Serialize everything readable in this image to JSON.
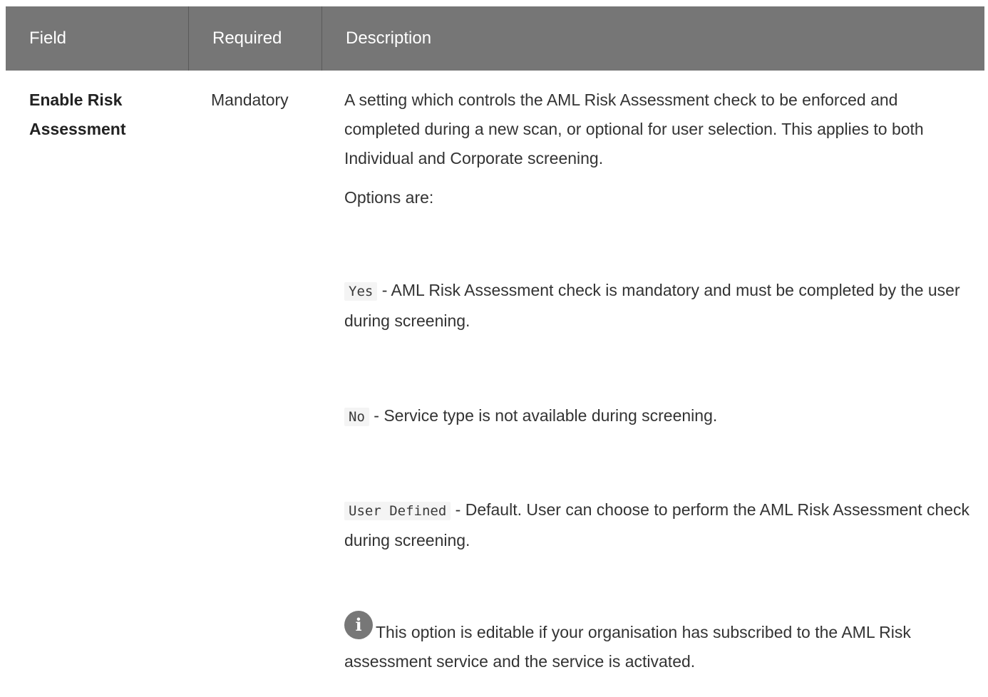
{
  "table": {
    "headers": {
      "field": "Field",
      "required": "Required",
      "description": "Description"
    },
    "row": {
      "field": "Enable Risk Assessment",
      "required": "Mandatory",
      "description": "A setting which controls the AML Risk Assessment check to be enforced and completed during a new scan, or optional for user selection. This applies to both Individual and Corporate screening.",
      "options_label": "Options are:",
      "options": [
        {
          "code": "Yes",
          "text": " - AML Risk Assessment check is mandatory and must be completed by the user during screening."
        },
        {
          "code": "No",
          "text": " - Service type is not available during screening."
        },
        {
          "code": "User Defined",
          "text": " - Default. User can choose to perform the AML Risk Assessment check during screening."
        }
      ],
      "note_icon": "info-icon",
      "note": "This option is editable if your organisation has subscribed to the AML Risk assessment service and the service is activated."
    }
  }
}
